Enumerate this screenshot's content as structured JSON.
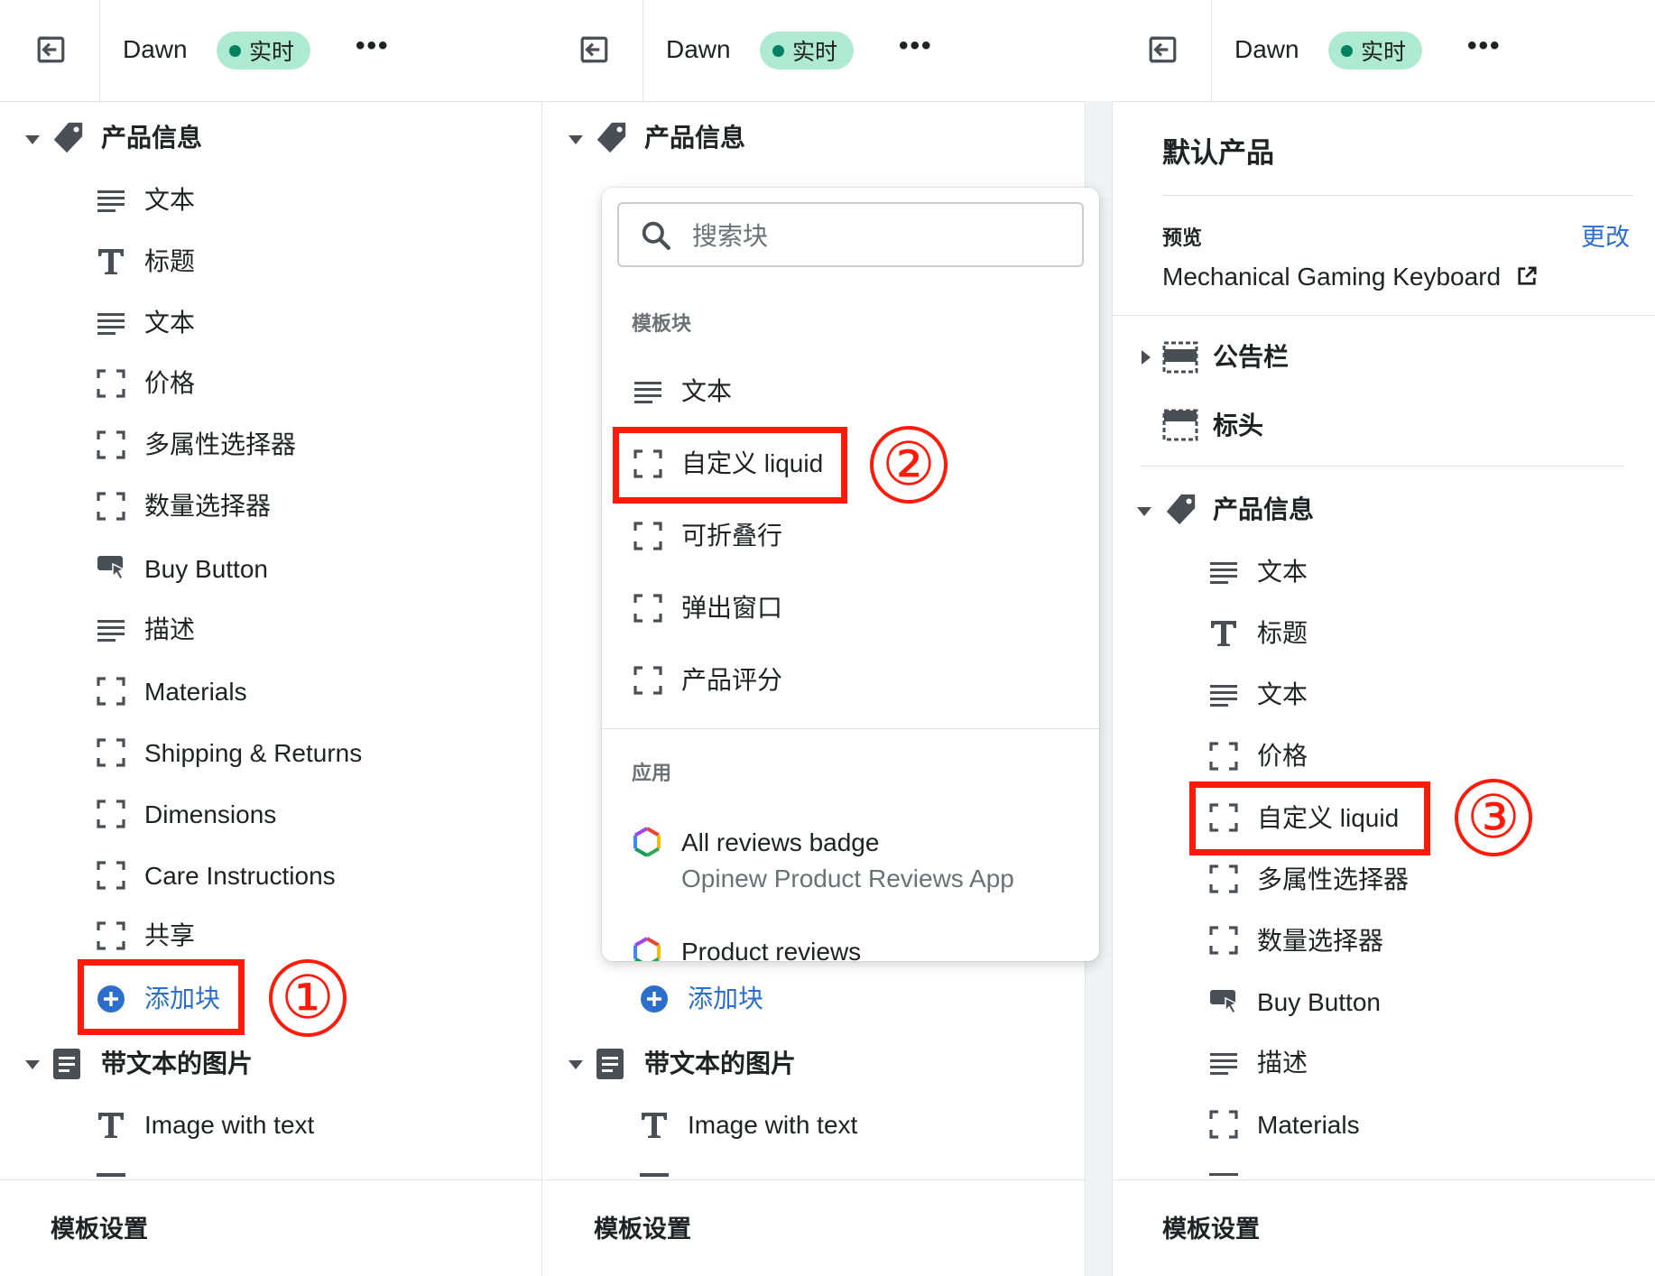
{
  "colors": {
    "accent_red": "#ff1a0a",
    "badge_bg": "#aee9d1",
    "badge_dot": "#008060",
    "link_blue": "#2c6ecb",
    "divider": "#e1e3e5"
  },
  "header": {
    "theme_name": "Dawn",
    "status_badge": "实时",
    "more_icon": "horizontal-dots-icon",
    "exit_icon": "exit-icon"
  },
  "panel1": {
    "section_product": "产品信息",
    "items": [
      "文本",
      "标题",
      "文本",
      "价格",
      "多属性选择器",
      "数量选择器",
      "Buy Button",
      "描述",
      "Materials",
      "Shipping & Returns",
      "Dimensions",
      "Care Instructions",
      "共享"
    ],
    "add_block": "添加块",
    "section_image_text": "带文本的图片",
    "image_text_item": "Image with text",
    "footer": "模板设置",
    "step": "①"
  },
  "panel2": {
    "section_product": "产品信息",
    "search_placeholder": "搜索块",
    "group_template": "模板块",
    "template_blocks": [
      "文本",
      "自定义 liquid",
      "可折叠行",
      "弹出窗口",
      "产品评分"
    ],
    "group_apps": "应用",
    "apps": [
      {
        "name": "All reviews badge",
        "provider": "Opinew Product Reviews App"
      },
      {
        "name": "Product reviews"
      }
    ],
    "add_block": "添加块",
    "section_image_text": "带文本的图片",
    "image_text_item": "Image with text",
    "footer": "模板设置",
    "step": "②"
  },
  "panel3": {
    "title": "默认产品",
    "preview_label": "预览",
    "change_link": "更改",
    "preview_product": "Mechanical Gaming Keyboard",
    "section_announcement": "公告栏",
    "section_header": "标头",
    "section_product": "产品信息",
    "items": [
      "文本",
      "标题",
      "文本",
      "价格",
      "自定义 liquid",
      "多属性选择器",
      "数量选择器",
      "Buy Button",
      "描述",
      "Materials"
    ],
    "footer": "模板设置",
    "step": "③"
  }
}
